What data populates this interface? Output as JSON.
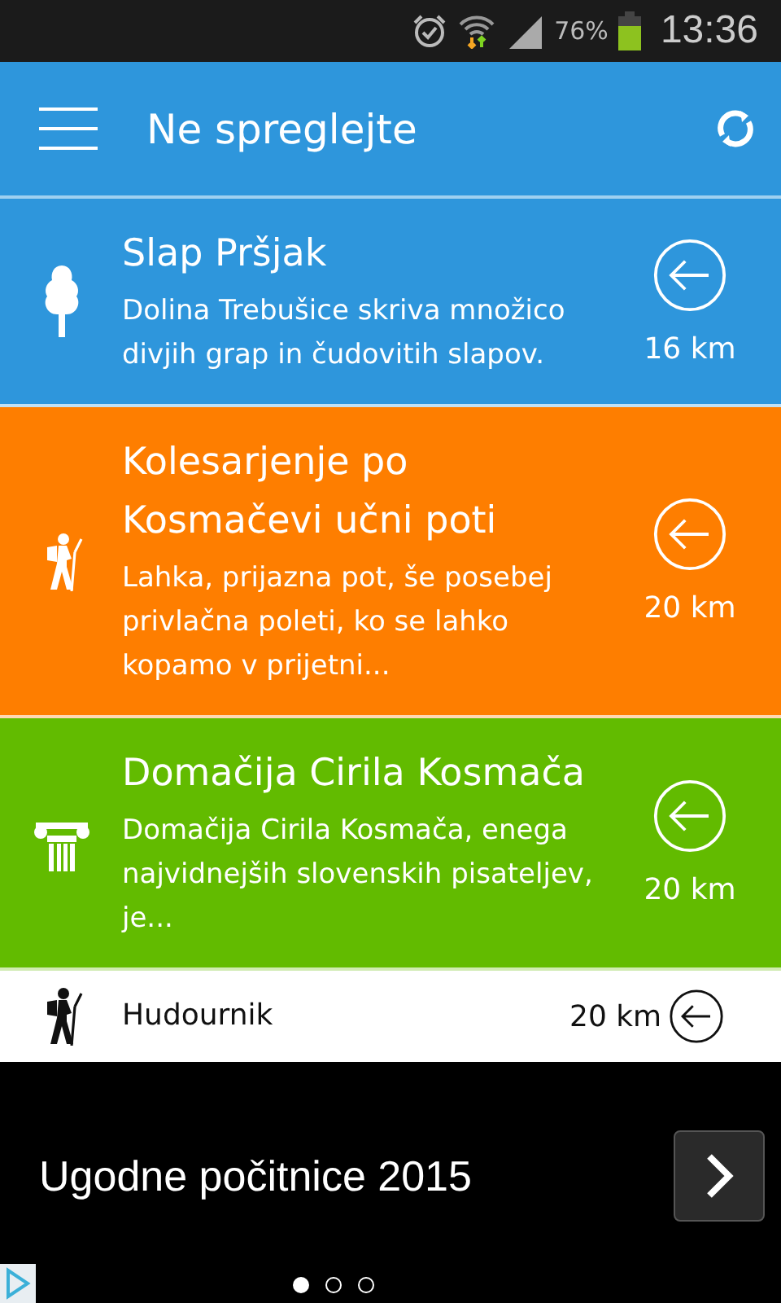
{
  "status_bar": {
    "battery": "76%",
    "time": "13:36"
  },
  "app_bar": {
    "title": "Ne spreglejte"
  },
  "cards": [
    {
      "kind": "tree",
      "color": "#2e96dc",
      "title": "Slap Pršjak",
      "description": "Dolina Trebušice skriva množico divjih grap in čudovitih slapov.",
      "distance": "16 km"
    },
    {
      "kind": "hiker",
      "color": "#fe7e00",
      "title": "Kolesarjenje po Kosmačevi učni poti",
      "description": "Lahka, prijazna pot, še posebej privlačna poleti, ko se lahko kopamo v prijetni...",
      "distance": "20 km"
    },
    {
      "kind": "column",
      "color": "#62bb00",
      "title": "Domačija Cirila Kosmača",
      "description": "Domačija Cirila Kosmača, enega najvidnejših slovenskih pisateljev, je...",
      "distance": "20 km"
    },
    {
      "kind": "hiker",
      "color": "#ffffff",
      "title": "Hudournik",
      "distance": "20 km"
    }
  ],
  "ad": {
    "text": "Ugodne počitnice 2015",
    "pages": [
      {
        "selected": true
      },
      {
        "selected": false
      },
      {
        "selected": false
      }
    ]
  }
}
